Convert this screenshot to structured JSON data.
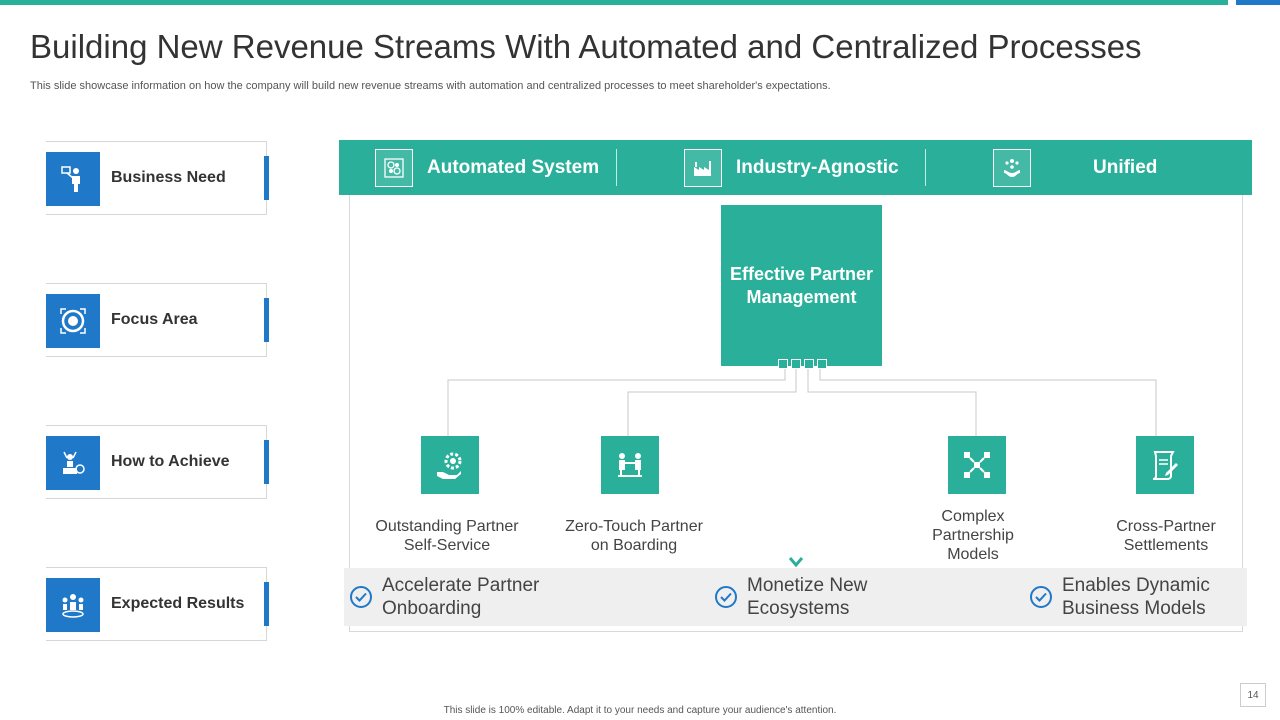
{
  "slide": {
    "title": "Building New Revenue Streams With Automated and Centralized Processes",
    "subtitle": "This slide showcase information on how the company will build new revenue streams with automation and centralized processes to meet shareholder's expectations.",
    "footer": "This slide is 100% editable. Adapt it to your needs and capture your audience's attention.",
    "page_number": "14",
    "colors": {
      "teal": "#2ab09a",
      "blue": "#1f78c8"
    }
  },
  "sidebar": {
    "cards": [
      {
        "label": "Business Need",
        "icon": "presenter-icon"
      },
      {
        "label": "Focus Area",
        "icon": "focus-target-icon"
      },
      {
        "label": "How to Achieve",
        "icon": "achievement-icon"
      },
      {
        "label": "Expected Results",
        "icon": "team-growth-icon"
      }
    ]
  },
  "diagram": {
    "header": [
      {
        "label": "Automated System",
        "icon": "automation-icon"
      },
      {
        "label": "Industry-Agnostic",
        "icon": "factory-icon"
      },
      {
        "label": "Unified",
        "icon": "network-hand-icon"
      }
    ],
    "center": "Effective Partner Management",
    "nodes": [
      {
        "label": "Outstanding Partner Self-Service",
        "icon": "service-gear-icon"
      },
      {
        "label": "Zero-Touch Partner on Boarding",
        "icon": "handshake-icon"
      },
      {
        "label": "Complex Partnership Models",
        "icon": "connection-icon"
      },
      {
        "label": "Cross-Partner Settlements",
        "icon": "document-sign-icon"
      }
    ],
    "results": [
      {
        "label": "Accelerate Partner Onboarding"
      },
      {
        "label": "Monetize New Ecosystems"
      },
      {
        "label": "Enables Dynamic Business Models"
      }
    ]
  }
}
